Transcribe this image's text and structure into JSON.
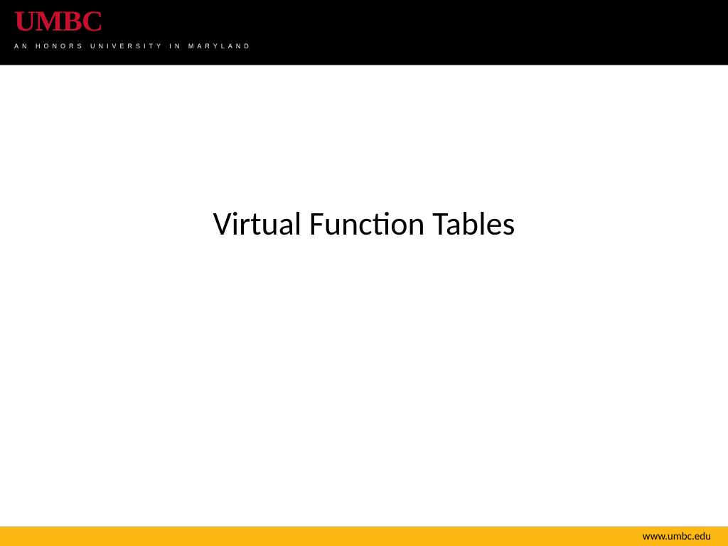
{
  "header": {
    "logo": "UMBC",
    "tagline": "AN HONORS UNIVERSITY IN MARYLAND"
  },
  "main": {
    "title": "Virtual Function Tables"
  },
  "footer": {
    "url": "www.umbc.edu"
  }
}
